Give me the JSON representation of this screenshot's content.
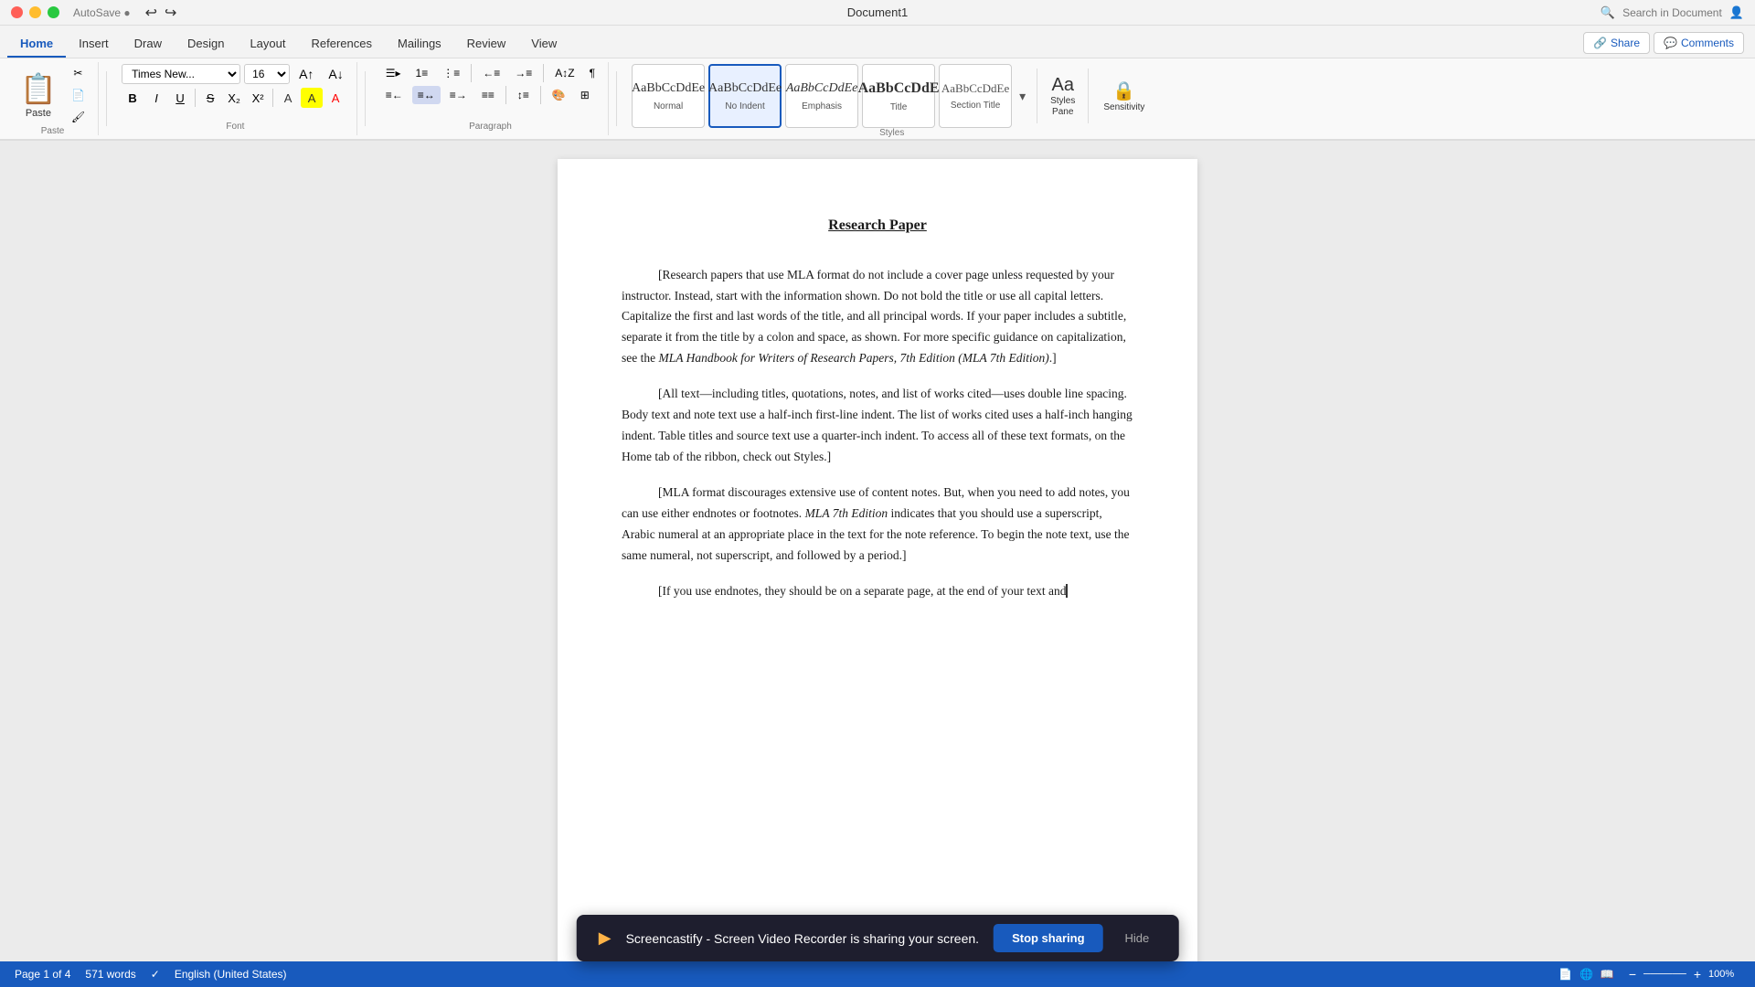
{
  "titleBar": {
    "docName": "Document1",
    "searchPlaceholder": "Search in Document"
  },
  "ribbonTabs": {
    "tabs": [
      "Home",
      "Insert",
      "Draw",
      "Design",
      "Layout",
      "References",
      "Mailings",
      "Review",
      "View"
    ],
    "activeTab": "Home"
  },
  "ribbon": {
    "sections": {
      "clipboard": {
        "label": "Paste"
      },
      "font": {
        "fontName": "Times New...",
        "fontSize": "16",
        "label": "Font"
      },
      "paragraph": {
        "label": "Paragraph"
      },
      "styles": {
        "label": "Styles"
      }
    },
    "formatButtons": [
      "B",
      "I",
      "U"
    ],
    "styleCards": [
      {
        "id": "normal",
        "preview": "AaBbCcDdEe",
        "label": "Normal"
      },
      {
        "id": "no-indent",
        "preview": "AaBbCcDdEe",
        "label": "No Indent",
        "active": true
      },
      {
        "id": "emphasis",
        "preview": "AaBbCcDdEe",
        "label": "Emphasis"
      },
      {
        "id": "title",
        "preview": "AaBbCcDdE",
        "label": "Title"
      },
      {
        "id": "section-title",
        "preview": "AaBbCcDdEe",
        "label": "Section Title"
      }
    ],
    "stylesPane": "Styles\nPane",
    "sensitivity": "Sensitivity"
  },
  "share": {
    "shareLabel": "Share",
    "commentsLabel": "Comments"
  },
  "document": {
    "title": "Research Paper",
    "paragraphs": [
      "[Research papers that use MLA format do not include a cover page unless requested by your instructor. Instead, start with the information shown. Do not bold the title or use all capital letters. Capitalize the first and last words of the title, and all principal words. If your paper includes a subtitle, separate it from the title by a colon and space, as shown. For more specific guidance on capitalization, see the MLA Handbook for Writers of Research Papers, 7th Edition (MLA 7th Edition).]",
      "[All text—including titles, quotations, notes, and list of works cited—uses double line spacing. Body text and note text use a half-inch first-line indent. The list of works cited uses a half-inch hanging indent. Table titles and source text use a quarter-inch indent. To access all of these text formats, on the Home tab of the ribbon, check out Styles.]",
      "[MLA format discourages extensive use of content notes. But, when you need to add notes, you can use either endnotes or footnotes. MLA 7th Edition indicates that you should use a superscript, Arabic numeral at an appropriate place in the text for the note reference. To begin the note text, use the same numeral, not superscript, and followed by a period.]",
      "[If you use endnotes, they should be on a separate page, at the end of your text and"
    ],
    "italicSpans": [
      "MLA Handbook for Writers of Research Papers, 7th Edition (MLA 7th Edition)",
      "MLA 7th Edition"
    ]
  },
  "statusBar": {
    "pageInfo": "Page 1 of 4",
    "wordCount": "571 words",
    "language": "English (United States)",
    "zoom": "100%"
  },
  "screencastify": {
    "message": "Screencastify - Screen Video Recorder is sharing your screen.",
    "stopButton": "Stop sharing",
    "hideButton": "Hide"
  }
}
